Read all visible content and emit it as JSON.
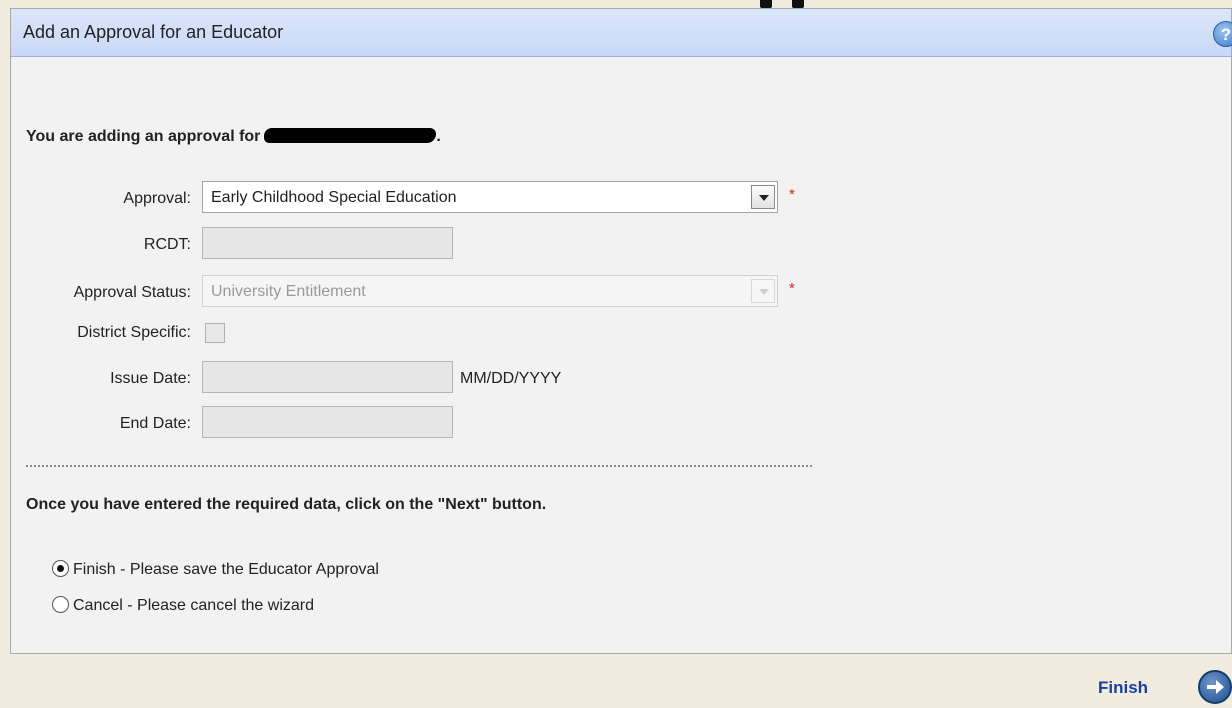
{
  "panel": {
    "title": "Add an Approval for an Educator",
    "help_icon": "question-mark-icon"
  },
  "intro": {
    "text": "You are adding an approval for",
    "end": "."
  },
  "form": {
    "approval": {
      "label": "Approval:",
      "value": "Early Childhood Special Education",
      "required_mark": "*"
    },
    "rcdt": {
      "label": "RCDT:",
      "value": ""
    },
    "approval_status": {
      "label": "Approval Status:",
      "value": "University Entitlement",
      "required_mark": "*"
    },
    "district_specific": {
      "label": "District Specific:",
      "checked": false
    },
    "issue_date": {
      "label": "Issue Date:",
      "value": "",
      "format_hint": "MM/DD/YYYY"
    },
    "end_date": {
      "label": "End Date:",
      "value": ""
    }
  },
  "instruction": "Once you have entered the required data, click on the \"Next\" button.",
  "options": [
    {
      "label": "Finish - Please save the Educator Approval",
      "selected": true
    },
    {
      "label": "Cancel - Please cancel the wizard",
      "selected": false
    }
  ],
  "footer": {
    "finish_label": "Finish",
    "next_icon": "arrow-right-circle-icon"
  },
  "colors": {
    "header_bg": "#c8d8f6",
    "required": "#d42222",
    "link": "#1a3fa0"
  }
}
